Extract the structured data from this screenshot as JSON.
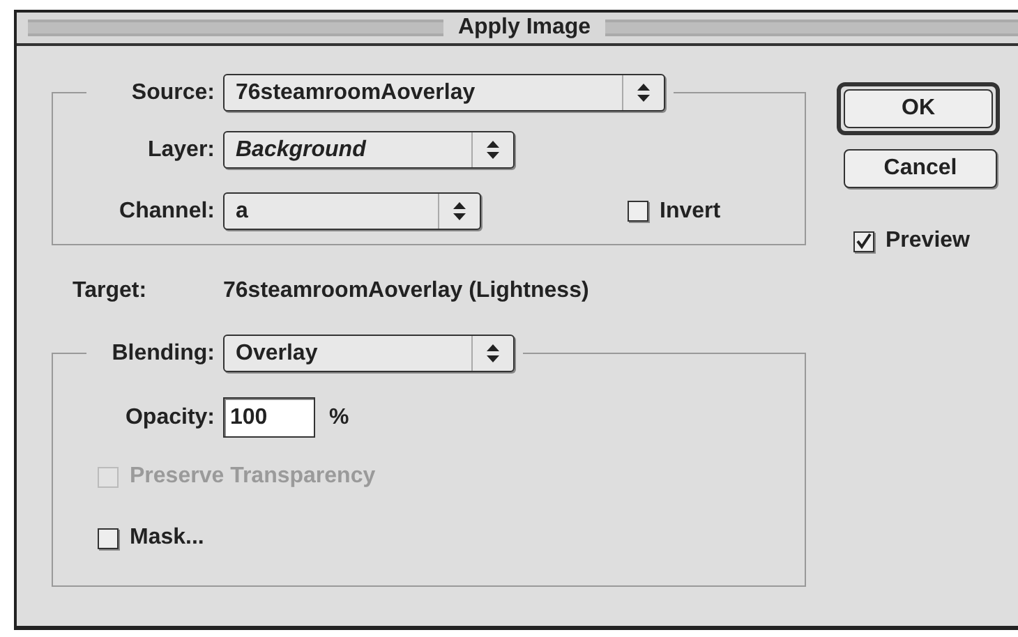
{
  "window": {
    "title": "Apply Image"
  },
  "source_group": {
    "source": {
      "label": "Source:",
      "value": "76steamroomAoverlay"
    },
    "layer": {
      "label": "Layer:",
      "value": "Background",
      "italic": true
    },
    "channel": {
      "label": "Channel:",
      "value": "a"
    },
    "invert": {
      "label": "Invert",
      "checked": false
    }
  },
  "target": {
    "label": "Target:",
    "value": "76steamroomAoverlay (Lightness)"
  },
  "blending_group": {
    "blending": {
      "label": "Blending:",
      "value": "Overlay"
    },
    "opacity": {
      "label": "Opacity:",
      "value": "100",
      "unit": "%"
    },
    "preserve_transparency": {
      "label": "Preserve Transparency",
      "checked": false,
      "disabled": true
    },
    "mask": {
      "label": "Mask...",
      "checked": false,
      "disabled": false
    }
  },
  "buttons": [
    {
      "label": "OK",
      "default": true
    },
    {
      "label": "Cancel",
      "default": false
    }
  ],
  "preview": {
    "label": "Preview",
    "checked": true
  }
}
